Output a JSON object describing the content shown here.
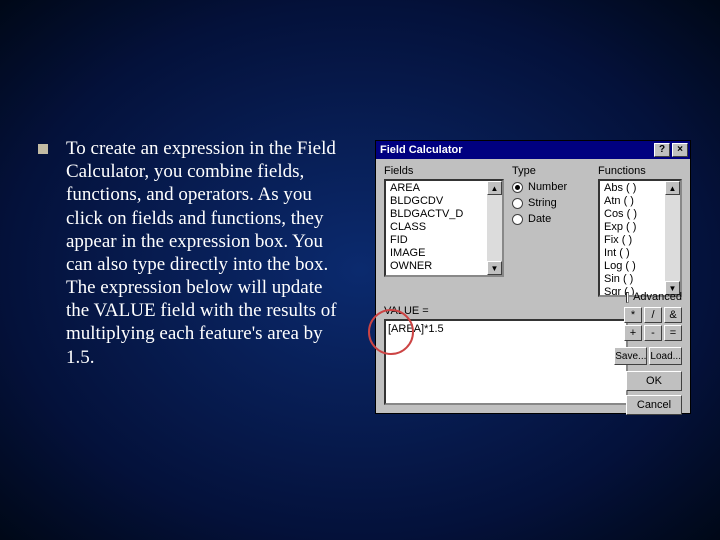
{
  "bullet": {
    "text": "To create an expression in the Field Calculator, you combine fields, functions, and operators. As you click on fields and functions, they appear in the expression box. You can also type directly into the box. The expression below will update the VALUE field with the results of multiplying each feature's area by 1.5."
  },
  "dialog": {
    "title": "Field Calculator",
    "help_btn": "?",
    "close_btn": "×",
    "fields_label": "Fields",
    "type_label": "Type",
    "functions_label": "Functions",
    "fields": [
      "AREA",
      "BLDGCDV",
      "BLDGACTV_D",
      "CLASS",
      "FID",
      "IMAGE",
      "OWNER"
    ],
    "types": {
      "number": "Number",
      "string": "String",
      "date": "Date"
    },
    "functions": [
      "Abs ( )",
      "Atn ( )",
      "Cos ( )",
      "Exp ( )",
      "Fix ( )",
      "Int ( )",
      "Log ( )",
      "Sin ( )",
      "Sqr ( )"
    ],
    "value_label": "VALUE =",
    "expression": "[AREA]*1.5",
    "advanced_label": "Advanced",
    "ops": [
      "*",
      "/",
      "&",
      "+",
      "-",
      "="
    ],
    "save_btn": "Save...",
    "load_btn": "Load...",
    "ok_btn": "OK",
    "cancel_btn": "Cancel"
  }
}
